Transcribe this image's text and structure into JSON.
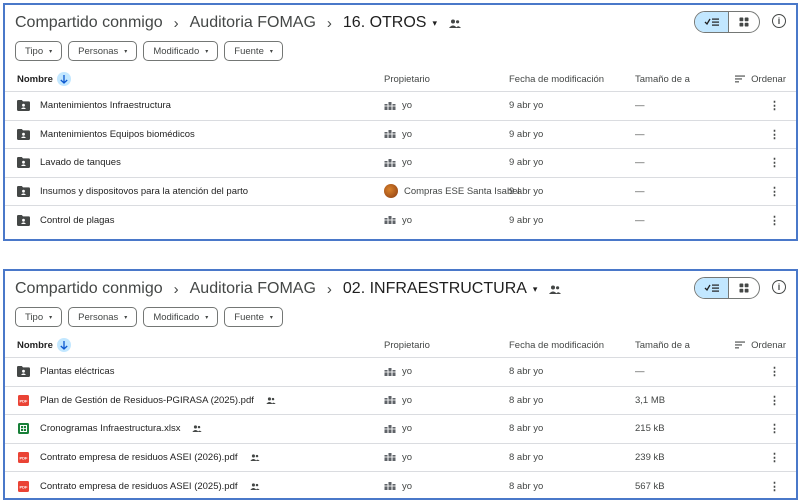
{
  "panels": [
    {
      "breadcrumb": {
        "root": "Compartido conmigo",
        "parent": "Auditoria FOMAG",
        "current": "16. OTROS"
      },
      "filters": [
        "Tipo",
        "Personas",
        "Modificado",
        "Fuente"
      ],
      "columns": {
        "name": "Nombre",
        "owner": "Propietario",
        "modified": "Fecha de modificación",
        "size": "Tamaño de a",
        "sort": "Ordenar"
      },
      "rows": [
        {
          "type": "folder-shared",
          "name": "Mantenimientos Infraestructura",
          "owner": "yo",
          "owner_kind": "org",
          "modified": "9 abr yo",
          "size": "—",
          "shared": false
        },
        {
          "type": "folder-shared",
          "name": "Mantenimientos Equipos biomédicos",
          "owner": "yo",
          "owner_kind": "org",
          "modified": "9 abr yo",
          "size": "—",
          "shared": false
        },
        {
          "type": "folder-shared",
          "name": "Lavado de tanques",
          "owner": "yo",
          "owner_kind": "org",
          "modified": "9 abr yo",
          "size": "—",
          "shared": false
        },
        {
          "type": "folder-shared",
          "name": "Insumos y dispositovos para la atención del parto",
          "owner": "Compras ESE Santa Isabel",
          "owner_kind": "avatar",
          "modified": "9 abr yo",
          "size": "—",
          "shared": false
        },
        {
          "type": "folder-shared",
          "name": "Control de plagas",
          "owner": "yo",
          "owner_kind": "org",
          "modified": "9 abr yo",
          "size": "—",
          "shared": false
        }
      ]
    },
    {
      "breadcrumb": {
        "root": "Compartido conmigo",
        "parent": "Auditoria FOMAG",
        "current": "02. INFRAESTRUCTURA"
      },
      "filters": [
        "Tipo",
        "Personas",
        "Modificado",
        "Fuente"
      ],
      "columns": {
        "name": "Nombre",
        "owner": "Propietario",
        "modified": "Fecha de modificación",
        "size": "Tamaño de a",
        "sort": "Ordenar"
      },
      "rows": [
        {
          "type": "folder-shared",
          "name": "Plantas eléctricas",
          "owner": "yo",
          "owner_kind": "org",
          "modified": "8 abr yo",
          "size": "—",
          "shared": false
        },
        {
          "type": "pdf",
          "name": "Plan de Gestión de Residuos-PGIRASA (2025).pdf",
          "owner": "yo",
          "owner_kind": "org",
          "modified": "8 abr yo",
          "size": "3,1 MB",
          "shared": true
        },
        {
          "type": "xlsx",
          "name": "Cronogramas Infraestructura.xlsx",
          "owner": "yo",
          "owner_kind": "org",
          "modified": "8 abr yo",
          "size": "215 kB",
          "shared": true
        },
        {
          "type": "pdf",
          "name": "Contrato empresa de residuos ASEI (2026).pdf",
          "owner": "yo",
          "owner_kind": "org",
          "modified": "8 abr yo",
          "size": "239 kB",
          "shared": true
        },
        {
          "type": "pdf",
          "name": "Contrato empresa de residuos ASEI (2025).pdf",
          "owner": "yo",
          "owner_kind": "org",
          "modified": "8 abr yo",
          "size": "567 kB",
          "shared": true
        }
      ]
    }
  ],
  "icons": {
    "caret": "▾",
    "more": "⋮",
    "info": "i",
    "breadcrumb_sep": "›",
    "sort": "sort-lines-icon",
    "list_view": "check-list-icon",
    "grid_view": "grid-icon"
  },
  "colors": {
    "accent": "#4a78c9",
    "toggle_active": "#c2e7ff",
    "pdf": "#ea4335",
    "sheet": "#188038",
    "folder": "#444746"
  }
}
